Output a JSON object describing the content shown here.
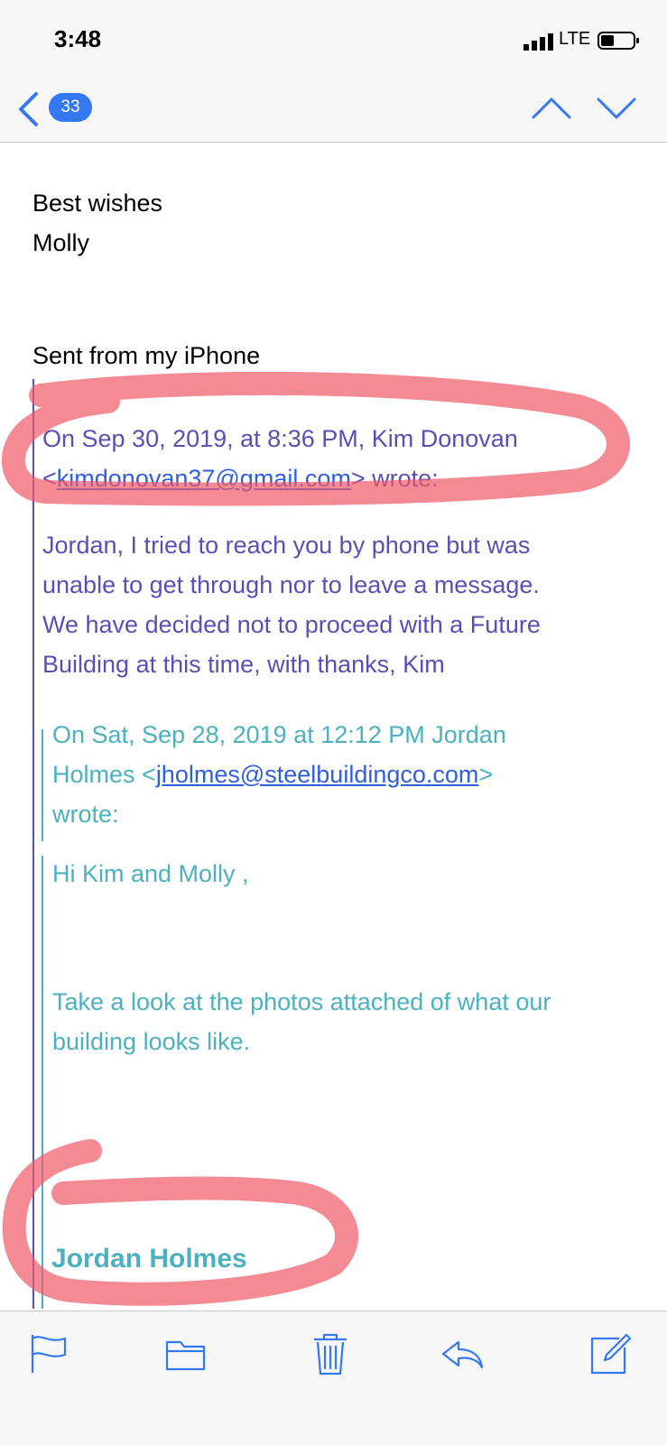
{
  "status_bar": {
    "time": "3:48",
    "network": "LTE"
  },
  "nav": {
    "unread_count": "33"
  },
  "message": {
    "closing": "Best wishes",
    "sender_name": "Molly",
    "signature_line": "Sent from my iPhone",
    "quote1": {
      "header_prefix": "On Sep 30, 2019, at 8:36 PM, Kim Donovan",
      "header_email": "kimdonovan37@gmail.com",
      "header_suffix": "wrote:",
      "body_lines": [
        "Jordan, I tried to reach you by phone but was",
        "unable to get through nor to leave a message.",
        "We have decided not to proceed with a Future",
        "Building at this time, with thanks, Kim"
      ]
    },
    "quote2": {
      "header_line1": "On Sat, Sep 28, 2019 at 12:12 PM Jordan",
      "header_name": "Holmes",
      "header_email": "jholmes@steelbuildingco.com",
      "header_suffix": "wrote:",
      "greeting": "Hi Kim and Molly ,",
      "body_lines": [
        "Take a look at the photos attached of what our",
        "building looks like."
      ],
      "signature": "Jordan Holmes"
    }
  },
  "toolbar": {
    "icons": [
      "flag-icon",
      "folder-icon",
      "trash-icon",
      "reply-icon",
      "compose-icon"
    ]
  },
  "colors": {
    "accent": "#3478f6",
    "quote1_text": "#5b4eb6",
    "quote2_text": "#4bb1c1",
    "link": "#2f5fe0",
    "marker": "#ef5a66"
  }
}
